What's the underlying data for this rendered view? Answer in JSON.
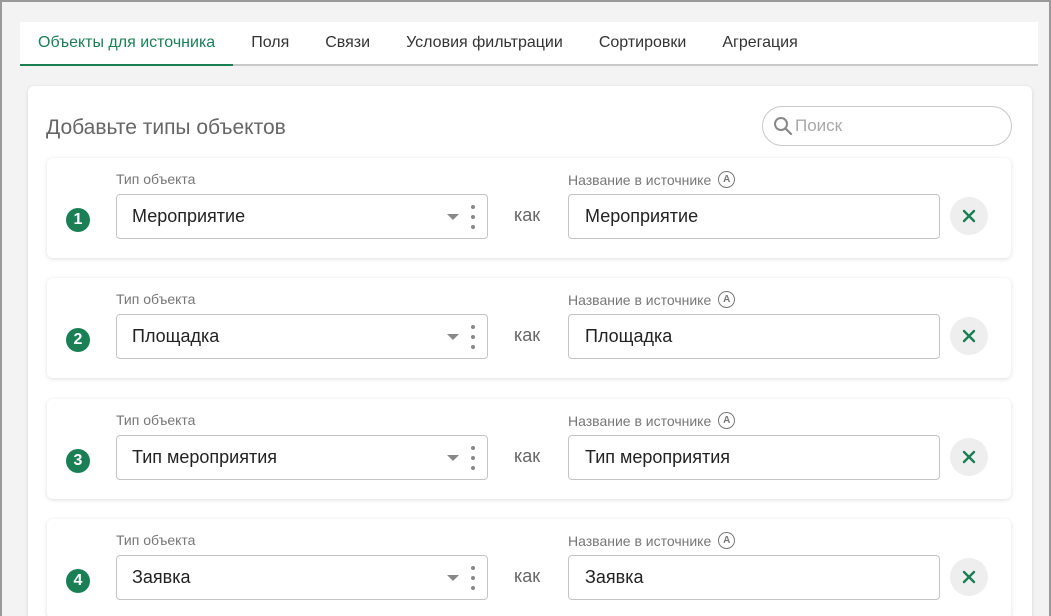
{
  "tabs": [
    {
      "label": "Объекты для источника",
      "active": true
    },
    {
      "label": "Поля",
      "active": false
    },
    {
      "label": "Связи",
      "active": false
    },
    {
      "label": "Условия фильтрации",
      "active": false
    },
    {
      "label": "Сортировки",
      "active": false
    },
    {
      "label": "Агрегация",
      "active": false
    }
  ],
  "panel": {
    "title": "Добавьте типы объектов",
    "search_placeholder": "Поиск"
  },
  "labels": {
    "object_type": "Тип объекта",
    "source_name": "Название в источнике",
    "as": "как",
    "auto_badge": "A"
  },
  "rows": [
    {
      "number": "1",
      "object_type": "Мероприятие",
      "source_name": "Мероприятие"
    },
    {
      "number": "2",
      "object_type": "Площадка",
      "source_name": "Площадка"
    },
    {
      "number": "3",
      "object_type": "Тип мероприятия",
      "source_name": "Тип мероприятия"
    },
    {
      "number": "4",
      "object_type": "Заявка",
      "source_name": "Заявка"
    }
  ],
  "colors": {
    "accent": "#1a7f55",
    "border": "#c4c4c4"
  },
  "icons": {
    "search": "search-icon",
    "remove": "close-icon",
    "menu": "vertical-dots-icon",
    "dropdown": "chevron-down-icon"
  }
}
